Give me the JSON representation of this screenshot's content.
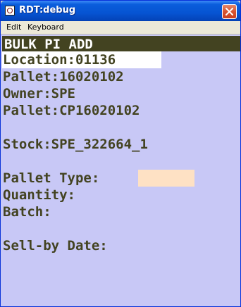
{
  "window": {
    "title": "RDT:debug",
    "close_icon": "close-icon"
  },
  "menu": {
    "items": [
      "Edit",
      "Keyboard"
    ]
  },
  "screen": {
    "header": "BULK PI ADD",
    "location": "Location:01136",
    "pallet": "Pallet:16020102",
    "owner": "Owner:SPE",
    "pallet_cp": "Pallet:CP16020102",
    "stock": "Stock:SPE_322664_1",
    "pallet_type_label": "Pallet Type:",
    "pallet_type_value": "",
    "quantity_label": "Quantity:",
    "batch_label": "Batch:",
    "sell_by_label": "Sell-by Date:"
  },
  "colors": {
    "screen_bg": "#c8c8f6",
    "text": "#434321",
    "header_bg": "#434321",
    "input_bg": "#fee1c4",
    "titlebar": "#0654d2"
  }
}
